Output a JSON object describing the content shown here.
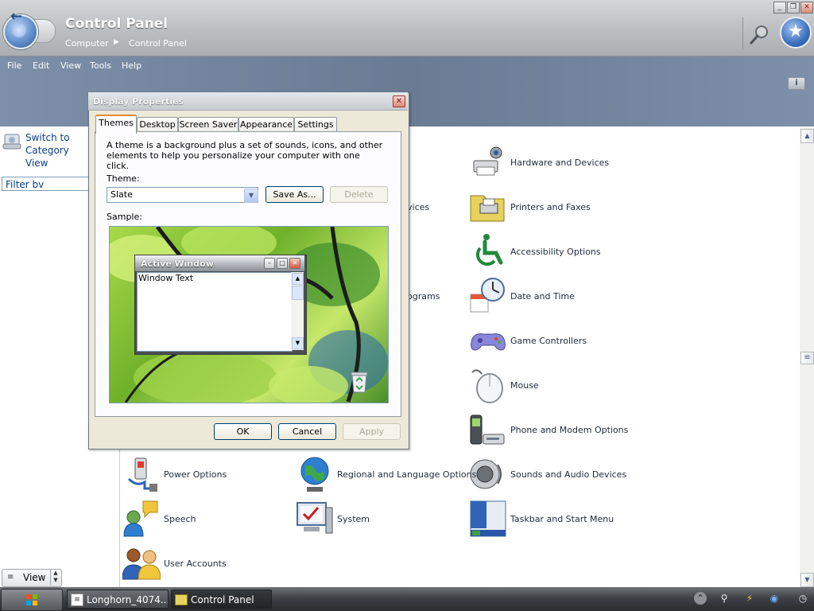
{
  "window": {
    "title": "Control Panel",
    "breadcrumb": [
      "Computer",
      "Control Panel"
    ],
    "caption_buttons": [
      "_",
      "❐",
      "✕"
    ]
  },
  "menu": [
    "File",
    "Edit",
    "View",
    "Tools",
    "Help"
  ],
  "left_pane": {
    "switch_label": "Switch to Category View",
    "filter_value": "Filter bv",
    "view_button": "View"
  },
  "content": {
    "items": [
      {
        "label": "Hardware and Devices",
        "icon": "hardware-icon"
      },
      {
        "label": "Printers and Faxes",
        "icon": "printer-icon"
      },
      {
        "label": "Accessibility Options",
        "icon": "accessibility-icon"
      },
      {
        "label": "Date and Time",
        "icon": "clock-icon"
      },
      {
        "label": "Game Controllers",
        "icon": "gamepad-icon"
      },
      {
        "label": "Mouse",
        "icon": "mouse-icon"
      },
      {
        "label": "Phone and Modem Options",
        "icon": "phone-icon"
      },
      {
        "label": "Sounds and Audio Devices",
        "icon": "speaker-icon"
      },
      {
        "label": "Taskbar and Start Menu",
        "icon": "taskbar-icon"
      },
      {
        "label": "Power Options",
        "icon": "power-icon"
      },
      {
        "label": "Regional and Language Options",
        "icon": "globe-icon"
      },
      {
        "label": "System",
        "icon": "system-icon"
      },
      {
        "label": "Speech",
        "icon": "speech-icon"
      },
      {
        "label": "User Accounts",
        "icon": "users-icon"
      }
    ],
    "partial_labels": [
      "vices",
      "ograms"
    ]
  },
  "dialog": {
    "title": "Display Properties",
    "tabs": [
      "Themes",
      "Desktop",
      "Screen Saver",
      "Appearance",
      "Settings"
    ],
    "description": "A theme is a background plus a set of sounds, icons, and other elements to help you personalize your computer with one click.",
    "theme_label": "Theme:",
    "theme_value": "Slate",
    "save_as": "Save As...",
    "delete": "Delete",
    "sample_label": "Sample:",
    "active_window_title": "Active Window",
    "window_text": "Window Text",
    "ok": "OK",
    "cancel": "Cancel",
    "apply": "Apply"
  },
  "taskbar": {
    "tasks": [
      "Longhorn_4074...",
      "Control Panel"
    ]
  }
}
